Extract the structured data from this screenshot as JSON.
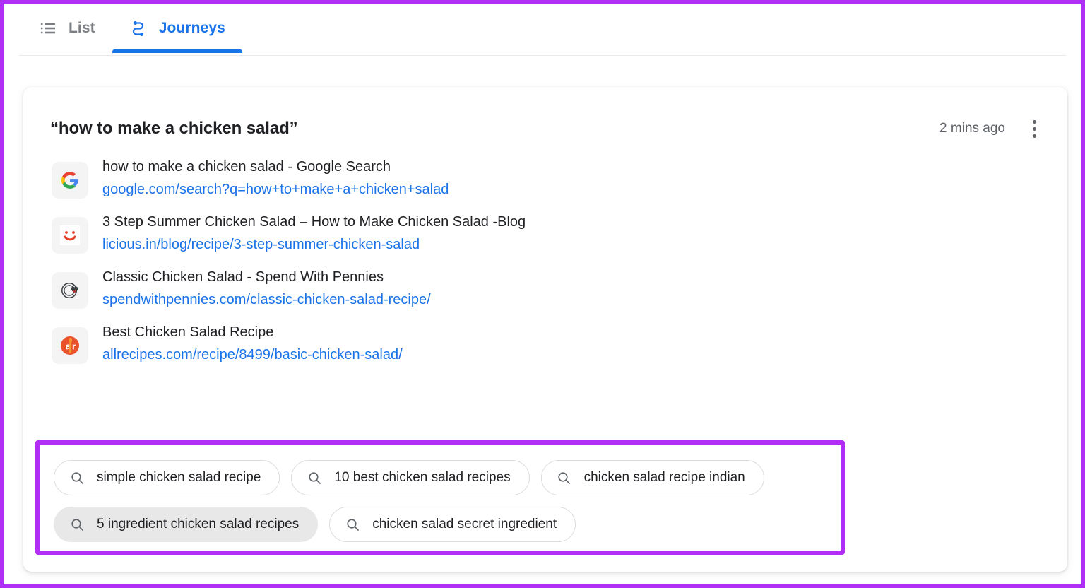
{
  "tabs": [
    {
      "label": "List",
      "icon": "list-icon",
      "active": false
    },
    {
      "label": "Journeys",
      "icon": "journey-path-icon",
      "active": true
    }
  ],
  "card": {
    "title": "“how to make a chicken salad”",
    "timestamp": "2 mins ago",
    "menu_icon": "more-vertical-icon"
  },
  "results": [
    {
      "favicon": "google-g-icon",
      "title": "how to make a chicken salad - Google Search",
      "url": "google.com/search?q=how+to+make+a+chicken+salad"
    },
    {
      "favicon": "licious-smiley-icon",
      "title": "3 Step Summer Chicken Salad – How to Make Chicken Salad -Blog",
      "url": "licious.in/blog/recipe/3-step-summer-chicken-salad"
    },
    {
      "favicon": "spend-with-pennies-icon",
      "title": "Classic Chicken Salad - Spend With Pennies",
      "url": "spendwithpennies.com/classic-chicken-salad-recipe/"
    },
    {
      "favicon": "allrecipes-icon",
      "title": "Best Chicken Salad Recipe",
      "url": "allrecipes.com/recipe/8499/basic-chicken-salad/"
    }
  ],
  "suggestions": [
    {
      "label": "simple chicken salad recipe",
      "hovered": false
    },
    {
      "label": "10 best chicken salad recipes",
      "hovered": false
    },
    {
      "label": "chicken salad recipe indian",
      "hovered": false
    },
    {
      "label": "5 ingredient chicken salad recipes",
      "hovered": true
    },
    {
      "label": "chicken salad secret ingredient",
      "hovered": false
    }
  ],
  "colors": {
    "accent_blue": "#1a73e8",
    "highlight_purple": "#b02ef5",
    "text_primary": "#202124",
    "text_secondary": "#5f6368"
  }
}
